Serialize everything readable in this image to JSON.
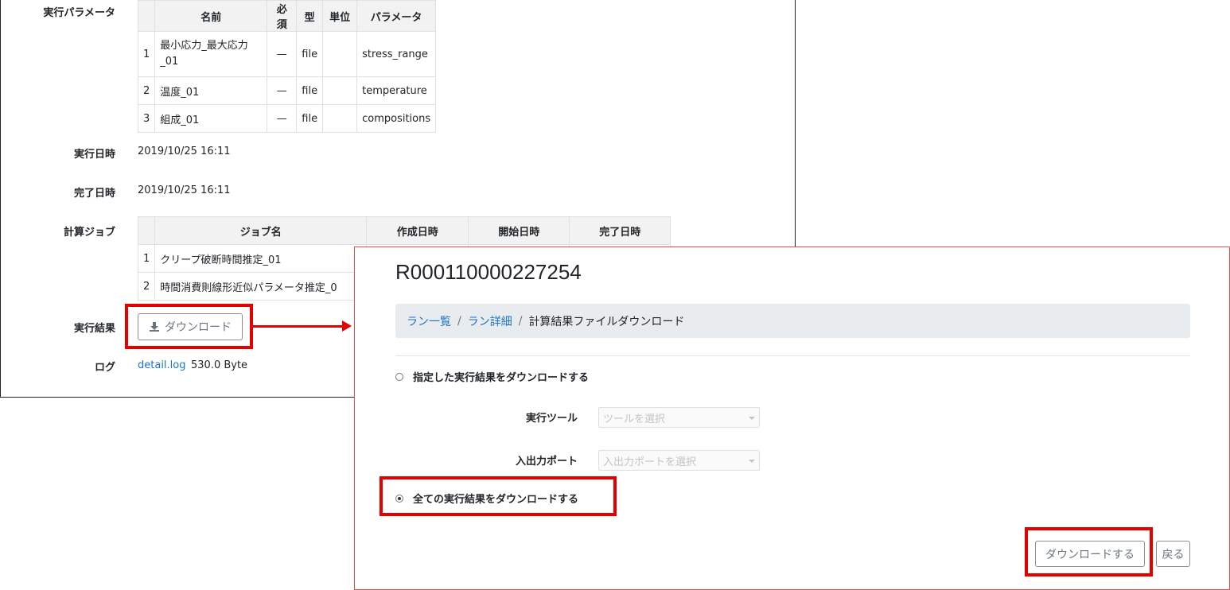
{
  "run_detail": {
    "params_label": "実行パラメータ",
    "params_table": {
      "headers": [
        "",
        "名前",
        "必須",
        "型",
        "単位",
        "パラメータ"
      ],
      "rows": [
        {
          "no": "1",
          "name": "最小応力_最大応力_01",
          "required": "—",
          "type": "file",
          "unit": "",
          "param": "stress_range"
        },
        {
          "no": "2",
          "name": "温度_01",
          "required": "—",
          "type": "file",
          "unit": "",
          "param": "temperature"
        },
        {
          "no": "3",
          "name": "組成_01",
          "required": "—",
          "type": "file",
          "unit": "",
          "param": "compositions"
        }
      ]
    },
    "exec_date_label": "実行日時",
    "exec_date": "2019/10/25 16:11",
    "done_date_label": "完了日時",
    "done_date": "2019/10/25 16:11",
    "jobs_label": "計算ジョブ",
    "jobs_table": {
      "headers": [
        "",
        "ジョブ名",
        "作成日時",
        "開始日時",
        "完了日時"
      ],
      "rows": [
        {
          "no": "1",
          "name": "クリープ破断時間推定_01"
        },
        {
          "no": "2",
          "name": "時間消費則線形近似パラメータ推定_0"
        }
      ]
    },
    "result_label": "実行結果",
    "download_button": "ダウンロード",
    "log_label": "ログ",
    "log_link": "detail.log",
    "log_size": "530.0 Byte"
  },
  "download_page": {
    "run_id": "R000110000227254",
    "breadcrumb": {
      "run_list": "ラン一覧",
      "run_detail": "ラン詳細",
      "current": "計算結果ファイルダウンロード",
      "separator": "/"
    },
    "option_specified": "指定した実行結果をダウンロードする",
    "tool_label": "実行ツール",
    "tool_placeholder": "ツールを選択",
    "port_label": "入出力ポート",
    "port_placeholder": "入出力ポートを選択",
    "option_all": "全ての実行結果をダウンロードする",
    "selected_option": "all",
    "submit_button": "ダウンロードする",
    "back_button": "戻る"
  },
  "colors": {
    "highlight": "#e50000",
    "link": "#1a73c8",
    "breadcrumb_bg": "#e9ecef"
  }
}
